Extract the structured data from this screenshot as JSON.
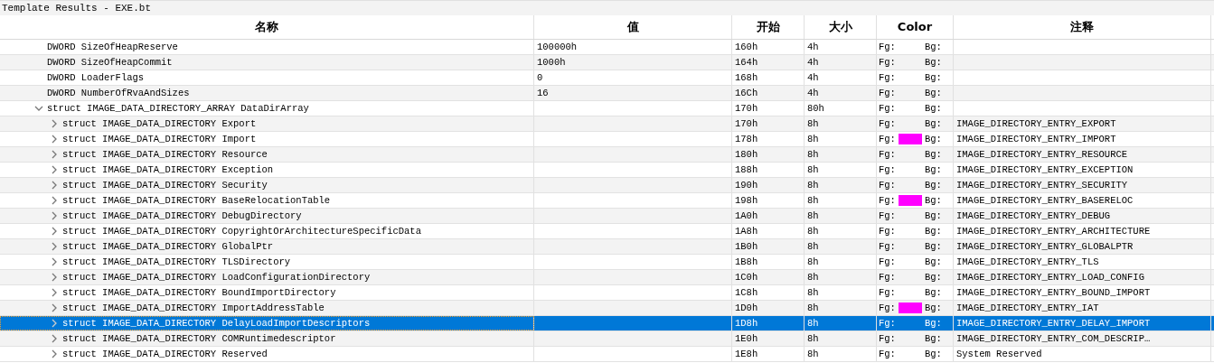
{
  "window": {
    "title": "Template Results - EXE.bt"
  },
  "table": {
    "columns": [
      "名称",
      "值",
      "开始",
      "大小",
      "Color",
      "注释"
    ],
    "rows": [
      {
        "name": "DWORD SizeOfHeapReserve",
        "value": "100000h",
        "start": "160h",
        "size": "4h",
        "fg_label": "Fg:",
        "bg_label": "Bg:",
        "selected": false
      },
      {
        "name": "DWORD SizeOfHeapCommit",
        "value": "1000h",
        "start": "164h",
        "size": "4h",
        "fg_label": "Fg:",
        "bg_label": "Bg:",
        "selected": false
      },
      {
        "name": "DWORD LoaderFlags",
        "value": "0",
        "start": "168h",
        "size": "4h",
        "fg_label": "Fg:",
        "bg_label": "Bg:",
        "selected": false
      },
      {
        "name": "DWORD NumberOfRvaAndSizes",
        "value": "16",
        "start": "16Ch",
        "size": "4h",
        "fg_label": "Fg:",
        "bg_label": "Bg:",
        "selected": false
      },
      {
        "name": "struct IMAGE_DATA_DIRECTORY_ARRAY DataDirArray",
        "start": "170h",
        "size": "80h",
        "fg_label": "Fg:",
        "bg_label": "Bg:",
        "selected": false,
        "expanded": true,
        "children": [
          {
            "name": "struct IMAGE_DATA_DIRECTORY Export",
            "start": "170h",
            "size": "8h",
            "fg_label": "Fg:",
            "bg_label": "Bg:",
            "comment": "IMAGE_DIRECTORY_ENTRY_EXPORT",
            "selected": false,
            "expanded": false
          },
          {
            "name": "struct IMAGE_DATA_DIRECTORY Import",
            "start": "178h",
            "size": "8h",
            "fg_label": "Fg:",
            "color": "#ff00ff",
            "bg_label": "Bg:",
            "comment": "IMAGE_DIRECTORY_ENTRY_IMPORT",
            "selected": false,
            "expanded": false
          },
          {
            "name": "struct IMAGE_DATA_DIRECTORY Resource",
            "start": "180h",
            "size": "8h",
            "fg_label": "Fg:",
            "bg_label": "Bg:",
            "comment": "IMAGE_DIRECTORY_ENTRY_RESOURCE",
            "selected": false,
            "expanded": false
          },
          {
            "name": "struct IMAGE_DATA_DIRECTORY Exception",
            "start": "188h",
            "size": "8h",
            "fg_label": "Fg:",
            "bg_label": "Bg:",
            "comment": "IMAGE_DIRECTORY_ENTRY_EXCEPTION",
            "selected": false,
            "expanded": false
          },
          {
            "name": "struct IMAGE_DATA_DIRECTORY Security",
            "start": "190h",
            "size": "8h",
            "fg_label": "Fg:",
            "bg_label": "Bg:",
            "comment": "IMAGE_DIRECTORY_ENTRY_SECURITY",
            "selected": false,
            "expanded": false
          },
          {
            "name": "struct IMAGE_DATA_DIRECTORY BaseRelocationTable",
            "start": "198h",
            "size": "8h",
            "fg_label": "Fg:",
            "color": "#ff00ff",
            "bg_label": "Bg:",
            "comment": "IMAGE_DIRECTORY_ENTRY_BASERELOC",
            "selected": false,
            "expanded": false
          },
          {
            "name": "struct IMAGE_DATA_DIRECTORY DebugDirectory",
            "start": "1A0h",
            "size": "8h",
            "fg_label": "Fg:",
            "bg_label": "Bg:",
            "comment": "IMAGE_DIRECTORY_ENTRY_DEBUG",
            "selected": false,
            "expanded": false
          },
          {
            "name": "struct IMAGE_DATA_DIRECTORY CopyrightOrArchitectureSpecificData",
            "start": "1A8h",
            "size": "8h",
            "fg_label": "Fg:",
            "bg_label": "Bg:",
            "comment": "IMAGE_DIRECTORY_ENTRY_ARCHITECTURE",
            "selected": false,
            "expanded": false
          },
          {
            "name": "struct IMAGE_DATA_DIRECTORY GlobalPtr",
            "start": "1B0h",
            "size": "8h",
            "fg_label": "Fg:",
            "bg_label": "Bg:",
            "comment": "IMAGE_DIRECTORY_ENTRY_GLOBALPTR",
            "selected": false,
            "expanded": false
          },
          {
            "name": "struct IMAGE_DATA_DIRECTORY TLSDirectory",
            "start": "1B8h",
            "size": "8h",
            "fg_label": "Fg:",
            "bg_label": "Bg:",
            "comment": "IMAGE_DIRECTORY_ENTRY_TLS",
            "selected": false,
            "expanded": false
          },
          {
            "name": "struct IMAGE_DATA_DIRECTORY LoadConfigurationDirectory",
            "start": "1C0h",
            "size": "8h",
            "fg_label": "Fg:",
            "bg_label": "Bg:",
            "comment": "IMAGE_DIRECTORY_ENTRY_LOAD_CONFIG",
            "selected": false,
            "expanded": false
          },
          {
            "name": "struct IMAGE_DATA_DIRECTORY BoundImportDirectory",
            "start": "1C8h",
            "size": "8h",
            "fg_label": "Fg:",
            "bg_label": "Bg:",
            "comment": "IMAGE_DIRECTORY_ENTRY_BOUND_IMPORT",
            "selected": false,
            "expanded": false
          },
          {
            "name": "struct IMAGE_DATA_DIRECTORY ImportAddressTable",
            "start": "1D0h",
            "size": "8h",
            "fg_label": "Fg:",
            "color": "#ff00ff",
            "bg_label": "Bg:",
            "comment": "IMAGE_DIRECTORY_ENTRY_IAT",
            "selected": false,
            "expanded": false
          },
          {
            "name": "struct IMAGE_DATA_DIRECTORY DelayLoadImportDescriptors",
            "start": "1D8h",
            "size": "8h",
            "fg_label": "Fg:",
            "bg_label": "Bg:",
            "comment": "IMAGE_DIRECTORY_ENTRY_DELAY_IMPORT",
            "selected": true,
            "expanded": false
          },
          {
            "name": "struct IMAGE_DATA_DIRECTORY COMRuntimedescriptor",
            "start": "1E0h",
            "size": "8h",
            "fg_label": "Fg:",
            "bg_label": "Bg:",
            "comment": "IMAGE_DIRECTORY_ENTRY_COM_DESCRIP…",
            "selected": false,
            "expanded": false
          },
          {
            "name": "struct IMAGE_DATA_DIRECTORY Reserved",
            "start": "1E8h",
            "size": "8h",
            "fg_label": "Fg:",
            "bg_label": "Bg:",
            "comment": "System Reserved",
            "selected": false,
            "expanded": false
          }
        ]
      }
    ]
  }
}
